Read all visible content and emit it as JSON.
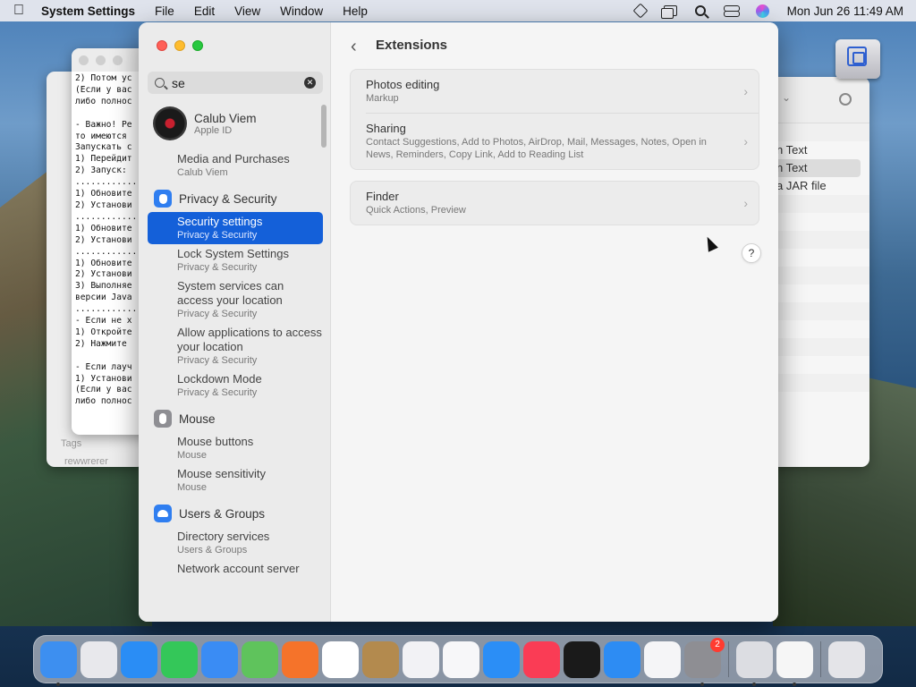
{
  "menubar": {
    "app_name": "System Settings",
    "menus": [
      "File",
      "Edit",
      "View",
      "Window",
      "Help"
    ],
    "clock": "Mon Jun 26  11:49 AM"
  },
  "background_editor": {
    "lines": "2) Потом ус\n(Если у вас\nлибо полнос\n\n- Важно! Ре\nто имеются\nЗапускать с\n1) Перейдит\n2) Запуск:\n............\n1) Обновите\n2) Установи\n............\n1) Обновите\n2) Установи\n............\n1) Обновите\n2) Установи\n3) Выполняе\nверсии Java\n............\n- Если не х\n1) Откройте\n2) Нажмите\n\n- Если лауч\n1) Установи\n(Если у вас\nлибо полнос"
  },
  "background_finder": {
    "tags_label": "Tags",
    "tag_item": "rewwrerer"
  },
  "background_right": {
    "rows": [
      "n Text",
      "n Text",
      "a JAR file"
    ]
  },
  "sidebar": {
    "search_value": "se",
    "search_placeholder": "Search",
    "profile": {
      "name": "Calub Viem",
      "sub": "Apple ID"
    },
    "media_item": {
      "title": "Media and Purchases",
      "sub": "Calub Viem"
    },
    "groups": [
      {
        "label": "Privacy & Security",
        "items": [
          {
            "title": "Security settings",
            "sub": "Privacy & Security",
            "selected": true
          },
          {
            "title": "Lock System Settings",
            "sub": "Privacy & Security"
          },
          {
            "title": "System services can access your location",
            "sub": "Privacy & Security"
          },
          {
            "title": "Allow applications to access your location",
            "sub": "Privacy & Security"
          },
          {
            "title": "Lockdown Mode",
            "sub": "Privacy & Security"
          }
        ]
      },
      {
        "label": "Mouse",
        "items": [
          {
            "title": "Mouse buttons",
            "sub": "Mouse"
          },
          {
            "title": "Mouse sensitivity",
            "sub": "Mouse"
          }
        ]
      },
      {
        "label": "Users & Groups",
        "items": [
          {
            "title": "Directory services",
            "sub": "Users & Groups"
          },
          {
            "title": "Network account server",
            "sub": ""
          }
        ]
      }
    ]
  },
  "content": {
    "title": "Extensions",
    "help_label": "?",
    "card1": [
      {
        "title": "Photos editing",
        "sub": "Markup"
      },
      {
        "title": "Sharing",
        "sub": "Contact Suggestions, Add to Photos, AirDrop, Mail, Messages, Notes, Open in News, Reminders, Copy Link, Add to Reading List"
      }
    ],
    "card2": [
      {
        "title": "Finder",
        "sub": "Quick Actions, Preview"
      }
    ]
  },
  "dock": {
    "apps": [
      {
        "name": "finder-app",
        "color": "#3d8ff0",
        "running": true
      },
      {
        "name": "launchpad-app",
        "color": "#e8e8ec",
        "running": false
      },
      {
        "name": "safari-app",
        "color": "#2a8df5",
        "running": false
      },
      {
        "name": "messages-app",
        "color": "#34c759",
        "running": false
      },
      {
        "name": "mail-app",
        "color": "#3a8cf4",
        "running": false
      },
      {
        "name": "maps-app",
        "color": "#5fc35c",
        "running": false
      },
      {
        "name": "firefox-app",
        "color": "#f5732a",
        "running": false
      },
      {
        "name": "chrome-app",
        "color": "#ffffff",
        "running": false
      },
      {
        "name": "contacts-app",
        "color": "#b38a4e",
        "running": false
      },
      {
        "name": "visual-studio-app",
        "color": "#f2f2f5",
        "running": false
      },
      {
        "name": "vscode-app",
        "color": "#f7f7f9",
        "running": false
      },
      {
        "name": "app-store-app",
        "color": "#2b8ef6",
        "running": false
      },
      {
        "name": "music-app",
        "color": "#fa3c55",
        "running": false
      },
      {
        "name": "apple-tv-app",
        "color": "#1a1a1a",
        "running": false
      },
      {
        "name": "keynote-app",
        "color": "#2d8cf3",
        "running": false
      },
      {
        "name": "news-app",
        "color": "#f5f5f7",
        "running": false
      },
      {
        "name": "system-settings-app",
        "color": "#8e8e93",
        "running": true,
        "badge": "2"
      }
    ],
    "right_apps": [
      {
        "name": "drive-app",
        "color": "#dcdde2",
        "running": true
      },
      {
        "name": "textedit-app",
        "color": "#f6f6f6",
        "running": true
      }
    ],
    "trash": {
      "name": "trash-app",
      "color": "#e4e4e8"
    }
  }
}
